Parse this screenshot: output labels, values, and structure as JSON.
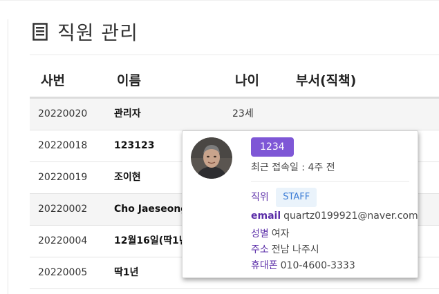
{
  "page": {
    "title": "직원 관리"
  },
  "table": {
    "headers": {
      "id": "사번",
      "name": "이름",
      "age": "나이",
      "dept": "부서(직책)"
    },
    "rows": [
      {
        "id": "20220020",
        "name": "관리자",
        "age": "23세"
      },
      {
        "id": "20220018",
        "name": "123123",
        "age": ""
      },
      {
        "id": "20220019",
        "name": "조이현",
        "age": ""
      },
      {
        "id": "20220002",
        "name": "Cho Jaeseong",
        "age": ""
      },
      {
        "id": "20220004",
        "name": "12월16일(딱1년",
        "age": ""
      },
      {
        "id": "20220005",
        "name": "딱1년",
        "age": ""
      }
    ]
  },
  "popover": {
    "name_badge": "1234",
    "last_login": "최근 접속일 : 4주 전",
    "position_label": "직위",
    "position_value": "STAFF",
    "email_label": "email",
    "email_value": "quartz0199921@naver.com",
    "gender_label": "성별",
    "gender_value": "여자",
    "address_label": "주소",
    "address_value": "전남 나주시",
    "phone_label": "휴대폰",
    "phone_value": "010-4600-3333"
  },
  "colors": {
    "accent": "#7e57d6",
    "label": "#5b2ea8",
    "chip_bg": "#eaf3fb",
    "chip_text": "#3a7bd5"
  },
  "icons": {
    "title_icon": "list-document-icon",
    "avatar": "user-photo"
  }
}
